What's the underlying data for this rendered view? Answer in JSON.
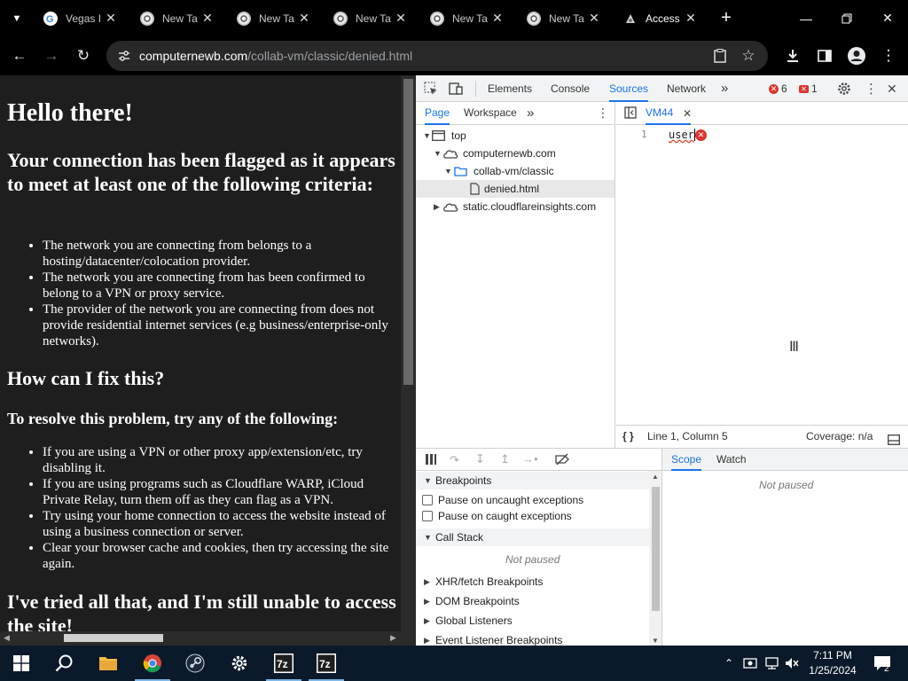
{
  "browser": {
    "tabs": [
      {
        "title": "Vegas I",
        "icon": "google-icon",
        "active": false
      },
      {
        "title": "New Ta",
        "icon": "chrome-icon",
        "active": false
      },
      {
        "title": "New Ta",
        "icon": "chrome-icon",
        "active": false
      },
      {
        "title": "New Ta",
        "icon": "chrome-icon",
        "active": false
      },
      {
        "title": "New Ta",
        "icon": "chrome-icon",
        "active": false
      },
      {
        "title": "New Ta",
        "icon": "chrome-icon",
        "active": false
      },
      {
        "title": "Access",
        "icon": "site-icon",
        "active": true
      }
    ],
    "new_tab_glyph": "+",
    "tab_close_glyph": "✕",
    "url_host": "computernewb.com",
    "url_path": "/collab-vm/classic/denied.html"
  },
  "page": {
    "h1": "Hello there!",
    "h2_flagged": "Your connection has been flagged as it appears to meet at least one of the following criteria:",
    "criteria": [
      "The network you are connecting from belongs to a hosting/datacenter/colocation provider.",
      "The network you are connecting from has been confirmed to belong to a VPN or proxy service.",
      "The provider of the network you are connecting from does not provide residential internet services (e.g business/enterprise-only networks)."
    ],
    "h2_fix": "How can I fix this?",
    "h3_resolve": "To resolve this problem, try any of the following:",
    "fixes": [
      "If you are using a VPN or other proxy app/extension/etc, try disabling it.",
      "If you are using programs such as Cloudflare WARP, iCloud Private Relay, turn them off as they can flag as a VPN.",
      "Try using your home connection to access the website instead of using a business connection or server.",
      "Clear your browser cache and cookies, then try accessing the site again."
    ],
    "h2_tried": "I've tried all that, and I'm still unable to access the site!"
  },
  "devtools": {
    "panels": [
      "Elements",
      "Console",
      "Sources",
      "Network"
    ],
    "active_panel": "Sources",
    "more_glyph": "»",
    "error_count": "6",
    "warning_count": "1",
    "navigator_tabs": [
      "Page",
      "Workspace"
    ],
    "tree": {
      "top": "top",
      "domain": "computernewb.com",
      "folder": "collab-vm/classic",
      "file": "denied.html",
      "other_domain": "static.cloudflareinsights.com"
    },
    "editor_tab": "VM44",
    "line_number": "1",
    "code_line": "user",
    "status_position": "Line 1, Column 5",
    "status_coverage": "Coverage: n/a",
    "debugger": {
      "breakpoints_label": "Breakpoints",
      "uncaught_label": "Pause on uncaught exceptions",
      "caught_label": "Pause on caught exceptions",
      "call_stack_label": "Call Stack",
      "not_paused": "Not paused",
      "sections": [
        "XHR/fetch Breakpoints",
        "DOM Breakpoints",
        "Global Listeners",
        "Event Listener Breakpoints"
      ]
    },
    "scope_tabs": [
      "Scope",
      "Watch"
    ],
    "scope_not_paused": "Not paused"
  },
  "taskbar": {
    "apps": [
      "windows-start",
      "search",
      "file-explorer",
      "chrome",
      "steam",
      "settings",
      "7zip",
      "7zip"
    ],
    "time": "7:11 PM",
    "date": "1/25/2024",
    "notification_count": "2"
  },
  "colors": {
    "accent": "#1a73e8",
    "error": "#dc362e",
    "page_bg": "#1e1e1e",
    "taskbar_bg": "#0a1a2a"
  }
}
